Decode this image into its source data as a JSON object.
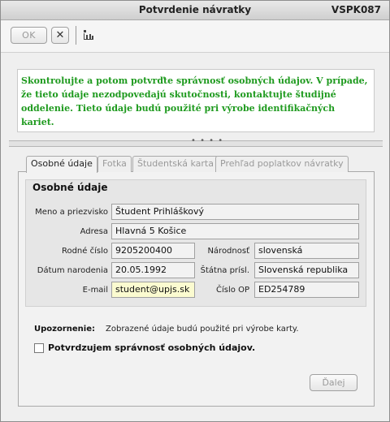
{
  "window": {
    "title": "Potvrdenie návratky",
    "code": "VSPK087"
  },
  "toolbar": {
    "ok_label": "OK",
    "close_label": "✕"
  },
  "info_message": "Skontrolujte a potom potvrďte správnosť osobných údajov. V prípade, že tieto údaje nezodpovedajú skutočnosti, kontaktujte študijné oddelenie. Tieto údaje budú použité pri výrobe identifikačných kariet.",
  "tabs": [
    {
      "label": "Osobné údaje",
      "active": true
    },
    {
      "label": "Fotka",
      "active": false
    },
    {
      "label": "Študentská karta",
      "active": false
    },
    {
      "label": "Prehľad poplatkov návratky",
      "active": false
    }
  ],
  "form": {
    "group_title": "Osobné údaje",
    "name_label": "Meno a priezvisko",
    "name_value": "Študent Prihláškový",
    "address_label": "Adresa",
    "address_value": "Hlavná 5 Košice",
    "birth_number_label": "Rodné číslo",
    "birth_number_value": "9205200400",
    "nationality_label": "Národnosť",
    "nationality_value": "slovenská",
    "birth_date_label": "Dátum narodenia",
    "birth_date_value": "20.05.1992",
    "citizenship_label": "Štátna prísl.",
    "citizenship_value": "Slovenská republika",
    "email_label": "E-mail",
    "email_value": "student@upjs.sk",
    "id_label": "Číslo OP",
    "id_value": "ED254789"
  },
  "note": {
    "label": "Upozornenie:",
    "text": "Zobrazené údaje budú použité pri výrobe karty."
  },
  "confirm_checkbox": {
    "label": "Potvrdzujem správnosť osobných údajov.",
    "checked": false
  },
  "next_button_label": "Ďalej",
  "colors": {
    "info_text": "#1e9a1e",
    "email_field": "#fbfbd0"
  }
}
